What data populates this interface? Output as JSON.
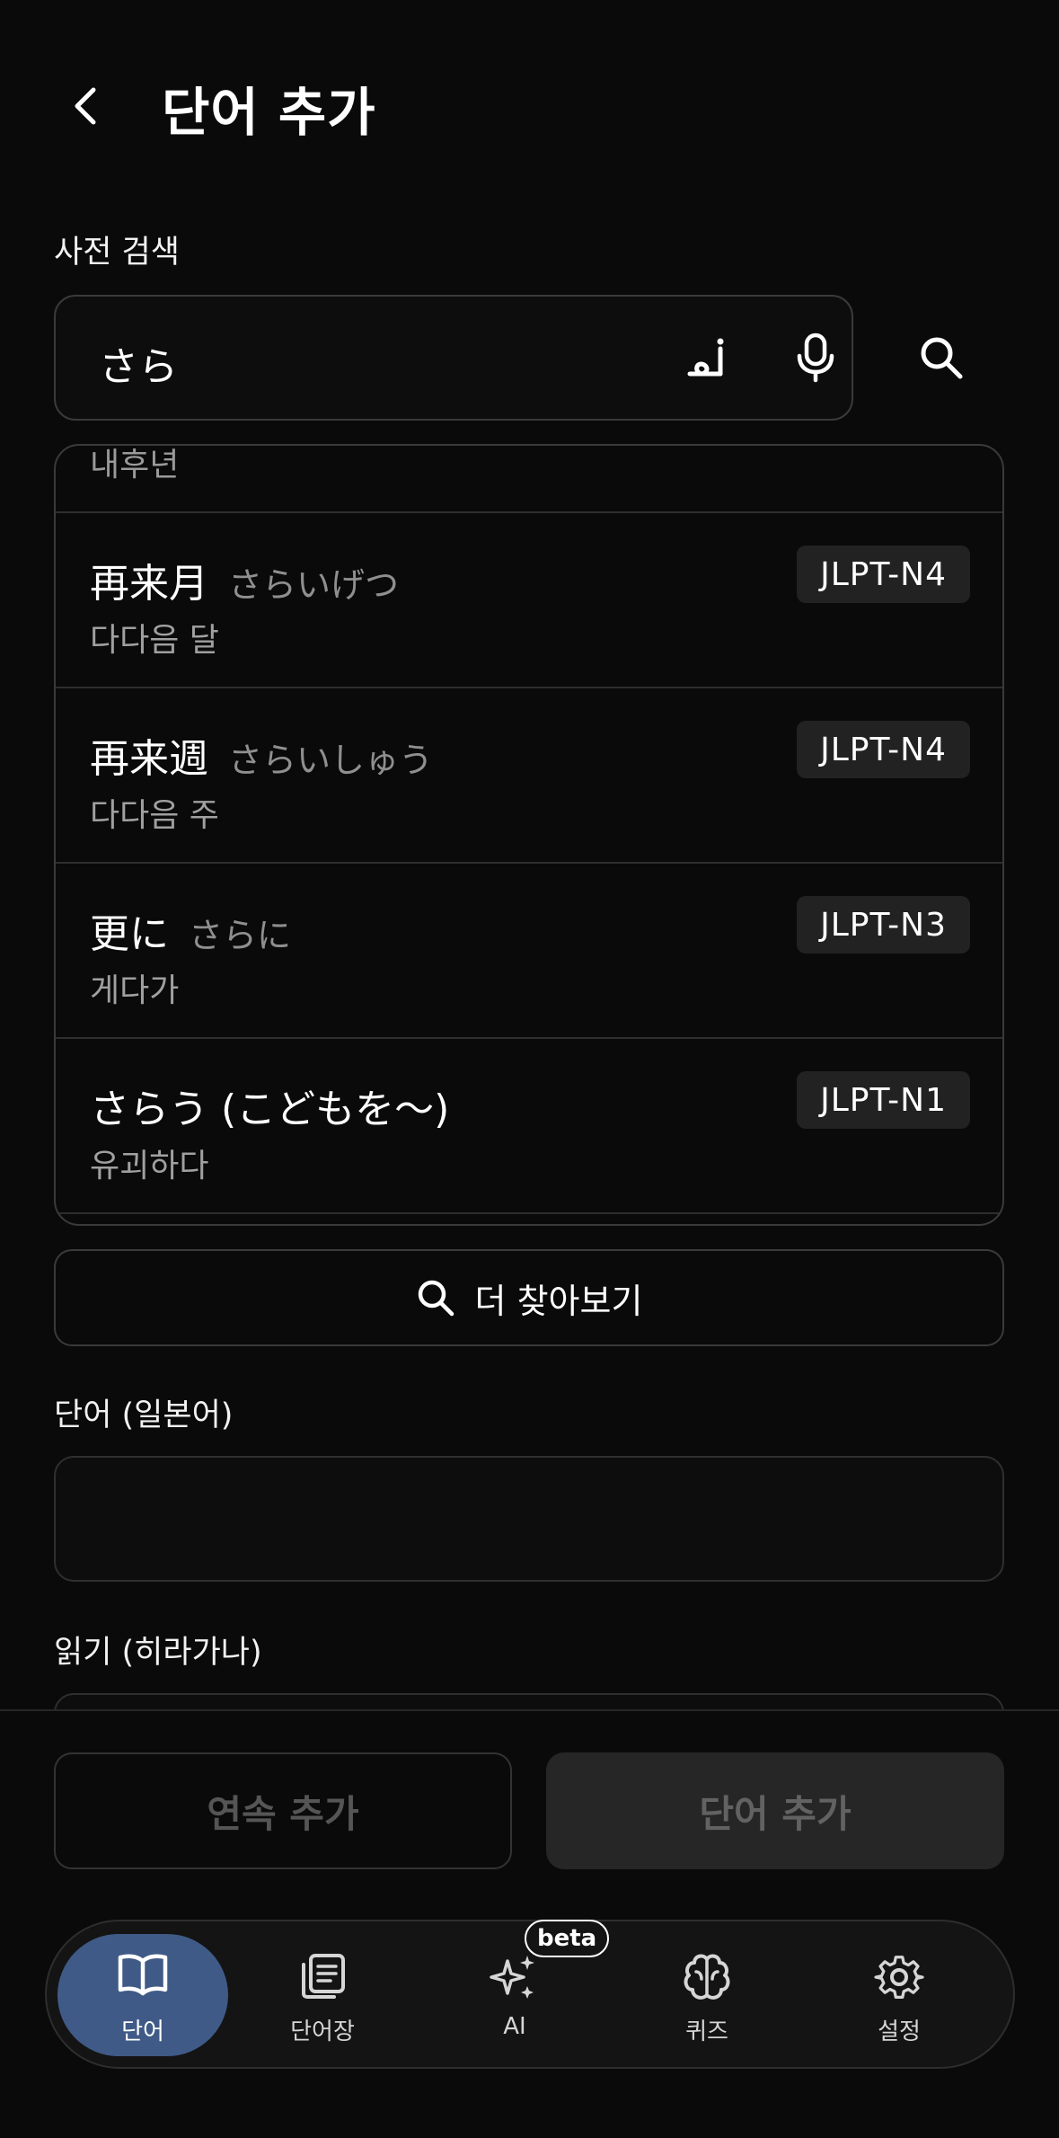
{
  "header": {
    "title": "단어 추가"
  },
  "search": {
    "label": "사전 검색",
    "query": "さら"
  },
  "results": {
    "partial_meaning": "내후년",
    "items": [
      {
        "word": "再来月",
        "reading": "さらいげつ",
        "meaning": "다다음 달",
        "level": "JLPT-N4"
      },
      {
        "word": "再来週",
        "reading": "さらいしゅう",
        "meaning": "다다음 주",
        "level": "JLPT-N4"
      },
      {
        "word": "更に",
        "reading": "さらに",
        "meaning": "게다가",
        "level": "JLPT-N3"
      },
      {
        "word": "さらう (こどもを～)",
        "reading": "",
        "meaning": "유괴하다",
        "level": "JLPT-N1"
      }
    ]
  },
  "more_button": "더 찾아보기",
  "fields": {
    "word_label": "단어 (일본어)",
    "word_value": "",
    "reading_label": "읽기 (히라가나)"
  },
  "actions": {
    "continue_add": "연속 추가",
    "add_word": "단어 추가"
  },
  "tabs": [
    {
      "label": "단어",
      "icon": "book-open-icon",
      "active": true
    },
    {
      "label": "단어장",
      "icon": "notebook-stack-icon",
      "active": false
    },
    {
      "label": "AI",
      "icon": "sparkles-icon",
      "active": false,
      "badge": "beta"
    },
    {
      "label": "퀴즈",
      "icon": "brain-icon",
      "active": false
    },
    {
      "label": "설정",
      "icon": "gear-icon",
      "active": false
    }
  ],
  "colors": {
    "background": "#0a0a0a",
    "active_tab": "#3f5a86",
    "badge_bg": "#222222",
    "muted_text": "#8f8f8f"
  }
}
